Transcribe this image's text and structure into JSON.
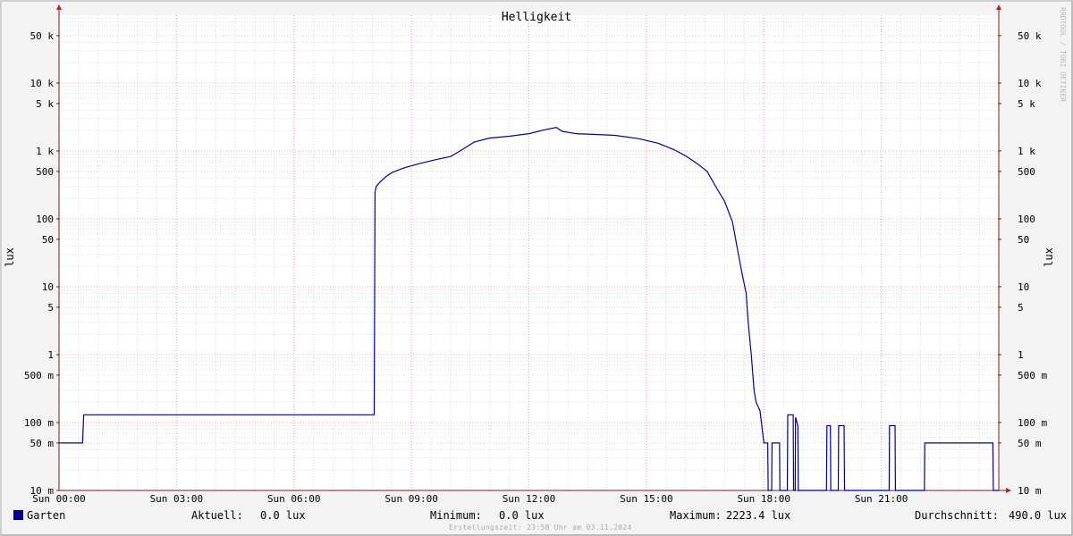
{
  "chart_data": {
    "type": "line",
    "title": "Helligkeit",
    "ylabel": "lux",
    "yscale": "log",
    "ylim": [
      0.01,
      100000
    ],
    "xlim": [
      0,
      24
    ],
    "watermark": "RRDTOOL / TOBI OETIKER",
    "x_ticks": [
      {
        "x": 0,
        "label": "Sun 00:00"
      },
      {
        "x": 3,
        "label": "Sun 03:00"
      },
      {
        "x": 6,
        "label": "Sun 06:00"
      },
      {
        "x": 9,
        "label": "Sun 09:00"
      },
      {
        "x": 12,
        "label": "Sun 12:00"
      },
      {
        "x": 15,
        "label": "Sun 15:00"
      },
      {
        "x": 18,
        "label": "Sun 18:00"
      },
      {
        "x": 21,
        "label": "Sun 21:00"
      }
    ],
    "y_ticks": [
      {
        "value": 50000,
        "label": "50 k"
      },
      {
        "value": 10000,
        "label": "10 k"
      },
      {
        "value": 5000,
        "label": "5 k"
      },
      {
        "value": 1000,
        "label": "1 k"
      },
      {
        "value": 500,
        "label": "500"
      },
      {
        "value": 100,
        "label": "100"
      },
      {
        "value": 50,
        "label": "50"
      },
      {
        "value": 10,
        "label": "10"
      },
      {
        "value": 5,
        "label": "5"
      },
      {
        "value": 1,
        "label": "1"
      },
      {
        "value": 0.5,
        "label": "500 m"
      },
      {
        "value": 0.1,
        "label": "100 m"
      },
      {
        "value": 0.05,
        "label": "50 m"
      },
      {
        "value": 0.01,
        "label": "10 m"
      }
    ],
    "colors": {
      "series": "#0000a0",
      "grid_major": "#e8a8a8",
      "grid_minor": "#d8d8d8",
      "axis": "#7a2020"
    },
    "series": [
      {
        "name": "Garten",
        "points": [
          [
            0.0,
            0.05
          ],
          [
            0.6,
            0.05
          ],
          [
            0.63,
            0.13
          ],
          [
            8.05,
            0.13
          ],
          [
            8.07,
            250
          ],
          [
            8.1,
            300
          ],
          [
            8.2,
            350
          ],
          [
            8.35,
            420
          ],
          [
            8.5,
            480
          ],
          [
            8.8,
            560
          ],
          [
            9.2,
            650
          ],
          [
            9.6,
            740
          ],
          [
            10.0,
            830
          ],
          [
            10.3,
            1050
          ],
          [
            10.6,
            1350
          ],
          [
            11.0,
            1550
          ],
          [
            11.5,
            1650
          ],
          [
            12.0,
            1800
          ],
          [
            12.4,
            2050
          ],
          [
            12.7,
            2223.4
          ],
          [
            12.85,
            1950
          ],
          [
            13.2,
            1800
          ],
          [
            13.7,
            1750
          ],
          [
            14.2,
            1700
          ],
          [
            14.8,
            1520
          ],
          [
            15.3,
            1300
          ],
          [
            15.7,
            1050
          ],
          [
            16.0,
            850
          ],
          [
            16.3,
            650
          ],
          [
            16.55,
            500
          ],
          [
            16.8,
            280
          ],
          [
            17.0,
            180
          ],
          [
            17.2,
            90
          ],
          [
            17.35,
            30
          ],
          [
            17.45,
            15
          ],
          [
            17.55,
            8
          ],
          [
            17.6,
            3
          ],
          [
            17.68,
            1
          ],
          [
            17.75,
            0.3
          ],
          [
            17.8,
            0.2
          ],
          [
            17.9,
            0.15
          ],
          [
            18.0,
            0.05
          ],
          [
            18.1,
            0.05
          ],
          [
            18.11,
            0.01
          ],
          [
            18.2,
            0.01
          ],
          [
            18.21,
            0.05
          ],
          [
            18.4,
            0.05
          ],
          [
            18.41,
            0.01
          ],
          [
            18.6,
            0.01
          ],
          [
            18.61,
            0.13
          ],
          [
            18.75,
            0.13
          ],
          [
            18.76,
            0.01
          ],
          [
            18.8,
            0.01
          ],
          [
            18.81,
            0.12
          ],
          [
            18.87,
            0.09
          ],
          [
            18.88,
            0.01
          ],
          [
            19.6,
            0.01
          ],
          [
            19.61,
            0.09
          ],
          [
            19.7,
            0.09
          ],
          [
            19.71,
            0.01
          ],
          [
            19.9,
            0.01
          ],
          [
            19.91,
            0.09
          ],
          [
            20.05,
            0.09
          ],
          [
            20.06,
            0.01
          ],
          [
            21.2,
            0.01
          ],
          [
            21.21,
            0.09
          ],
          [
            21.35,
            0.09
          ],
          [
            21.36,
            0.01
          ],
          [
            22.1,
            0.01
          ],
          [
            22.11,
            0.05
          ],
          [
            23.85,
            0.05
          ],
          [
            23.86,
            0.01
          ],
          [
            24.0,
            0.01
          ]
        ]
      }
    ],
    "legend": {
      "name": "Garten",
      "current_label": "Aktuell:",
      "current_value": "0.0 lux",
      "min_label": "Minimum:",
      "min_value": "0.0 lux",
      "max_label": "Maximum:",
      "max_value": "2223.4 lux",
      "avg_label": "Durchschnitt:",
      "avg_value": "490.0 lux"
    },
    "credit": "Erstellungszeit: 23:58 Uhr am 03.11.2024"
  }
}
